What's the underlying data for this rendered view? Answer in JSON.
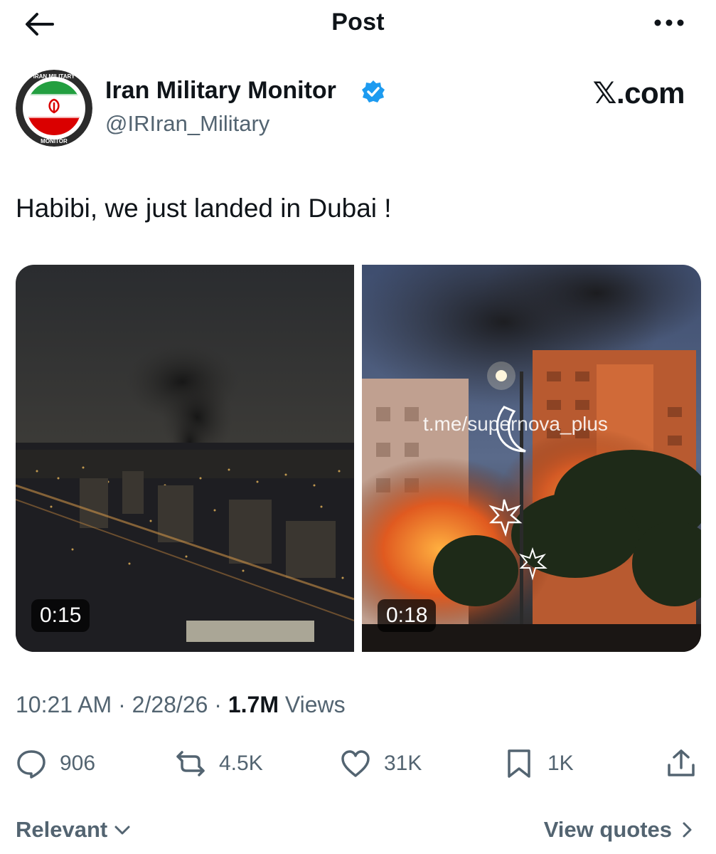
{
  "header": {
    "title": "Post",
    "back_icon": "arrow-left-icon",
    "more_icon": "more-dots-icon"
  },
  "author": {
    "display_name": "Iran Military Monitor",
    "handle": "@IRIran_Military",
    "verified": true,
    "verified_color": "#1d9bf0",
    "avatar_ring_text_top": "IRAN MILITARY",
    "avatar_ring_text_bottom": "MONITOR"
  },
  "brand": "𝕏.com",
  "tweet": {
    "text": "Habibi, we just landed in Dubai !"
  },
  "media": [
    {
      "duration": "0:15"
    },
    {
      "duration": "0:18",
      "watermark": "t.me/supernova_plus"
    }
  ],
  "meta": {
    "time": "10:21 AM",
    "sep1": " · ",
    "date": "2/28/26",
    "sep2": " · ",
    "views_count": "1.7M",
    "views_label": " Views"
  },
  "actions": {
    "reply": "906",
    "repost": "4.5K",
    "like": "31K",
    "bookmark": "1K"
  },
  "footer": {
    "sort_label": "Relevant",
    "quotes_label": "View quotes"
  },
  "colors": {
    "text": "#0f1419",
    "secondary": "#536471",
    "accent": "#1d9bf0"
  }
}
